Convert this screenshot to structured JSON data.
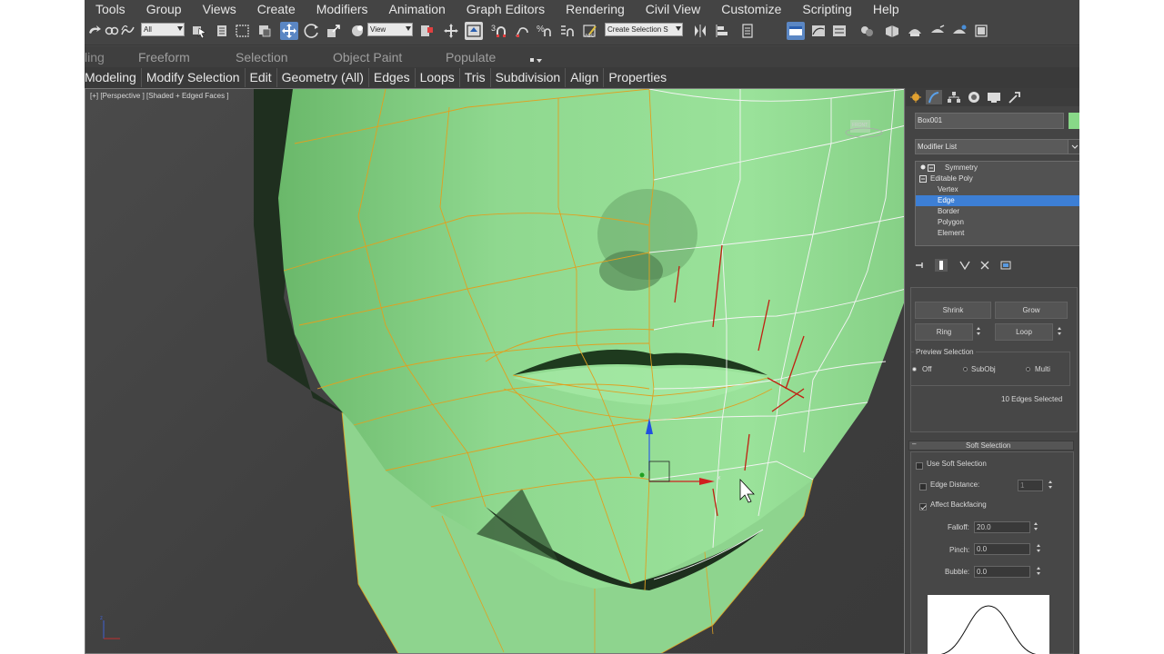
{
  "menu": [
    "Tools",
    "Group",
    "Views",
    "Create",
    "Modifiers",
    "Animation",
    "Graph Editors",
    "Rendering",
    "Civil View",
    "Customize",
    "Scripting",
    "Help"
  ],
  "toolbar": {
    "selection_filter": "All",
    "ref_coord": "View",
    "named_selection": "Create Selection S"
  },
  "ribbon_tabs": [
    "ling",
    "Freeform",
    "Selection",
    "Object Paint",
    "Populate"
  ],
  "ribbon_panel": [
    "Modeling",
    "Modify Selection",
    "Edit",
    "Geometry (All)",
    "Edges",
    "Loops",
    "Tris",
    "Subdivision",
    "Align",
    "Properties"
  ],
  "viewport": {
    "label": "[+] [Perspective ] [Shaded + Edged Faces ]",
    "viewcube_label": "FRONT",
    "model_color": "#8fd88f",
    "edge_color": "#e0a020",
    "selected_edge_color": "#c02010"
  },
  "command_panel": {
    "object_name": "Box001",
    "object_color": "#88d888",
    "modifier_list": "Modifier List",
    "stack": [
      {
        "label": "Symmetry",
        "level": 0
      },
      {
        "label": "Editable Poly",
        "level": 0
      },
      {
        "label": "Vertex",
        "level": 1
      },
      {
        "label": "Edge",
        "level": 1,
        "selected": true
      },
      {
        "label": "Border",
        "level": 1
      },
      {
        "label": "Polygon",
        "level": 1
      },
      {
        "label": "Element",
        "level": 1
      }
    ],
    "selection": {
      "shrink": "Shrink",
      "grow": "Grow",
      "ring": "Ring",
      "loop": "Loop",
      "preview_title": "Preview Selection",
      "preview_off": "Off",
      "preview_subobj": "SubObj",
      "preview_multi": "Multi",
      "status": "10 Edges Selected"
    },
    "soft_selection": {
      "title": "Soft Selection",
      "use_soft": "Use Soft Selection",
      "edge_distance": "Edge Distance:",
      "edge_distance_value": "1",
      "affect_backfacing": "Affect Backfacing",
      "falloff_label": "Falloff:",
      "falloff": "20.0",
      "pinch_label": "Pinch:",
      "pinch": "0.0",
      "bubble_label": "Bubble:",
      "bubble": "0.0"
    }
  }
}
